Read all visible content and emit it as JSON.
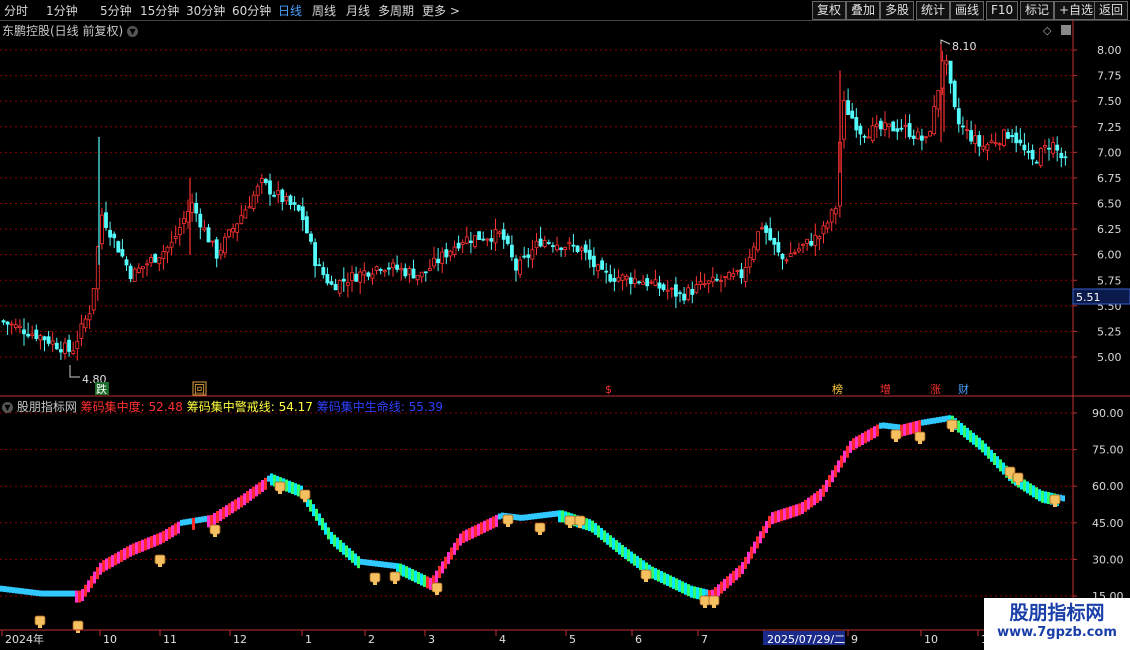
{
  "toolbar": {
    "periods": [
      "分时",
      "1分钟",
      "5分钟",
      "15分钟",
      "30分钟",
      "60分钟",
      "日线",
      "周线",
      "月线",
      "多周期",
      "更多 >"
    ],
    "active_period": "日线",
    "buttons": [
      "复权",
      "叠加",
      "多股",
      "统计",
      "画线",
      "F10",
      "标记",
      "+自选",
      "返回"
    ]
  },
  "stock": {
    "title": "东鹏控股(日线 前复权)"
  },
  "main_chart": {
    "price_ticks": [
      "8.00",
      "7.75",
      "7.50",
      "7.25",
      "7.00",
      "6.75",
      "6.50",
      "6.25",
      "6.00",
      "5.75",
      "5.50",
      "5.25",
      "5.00"
    ],
    "current_price": "5.51",
    "high_label": "8.10",
    "low_label": "4.80",
    "markers": [
      "跌",
      "回",
      "$",
      "榜",
      "增",
      "涨",
      "财"
    ]
  },
  "indicator": {
    "name": "股朋指标网",
    "line1_label": "筹码集中度: ",
    "line1_value": "52.48",
    "line2_label": "筹码集中警戒线: ",
    "line2_value": "54.17",
    "line3_label": "筹码集中生命线: ",
    "line3_value": "55.39",
    "ticks": [
      "90.00",
      "75.00",
      "60.00",
      "45.00",
      "30.00",
      "15.00"
    ]
  },
  "time_axis": {
    "labels": [
      "2024年",
      "10",
      "11",
      "12",
      "1",
      "2",
      "3",
      "4",
      "5",
      "6",
      "7",
      "2025/07/29/二",
      "9",
      "10",
      "1"
    ]
  },
  "watermark": {
    "line1": "股朋指标网",
    "line2": "www.7gpzb.com"
  },
  "colors": {
    "up": "#ff3333",
    "down": "#54fcfc",
    "grid": "#8b0000",
    "active": "#4aa0ff",
    "line1": "#ff3030",
    "line2": "#ffff40",
    "line3": "#3040ff"
  }
}
